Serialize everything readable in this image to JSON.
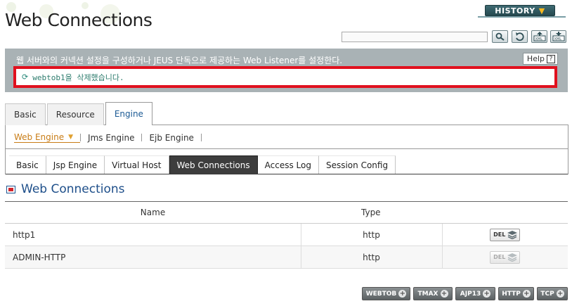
{
  "header": {
    "title": "Web Connections",
    "history_label": "HISTORY",
    "search": {
      "value": "",
      "placeholder": ""
    },
    "tools": [
      "search-icon",
      "refresh-icon",
      "export-xml-icon",
      "import-xml-icon"
    ]
  },
  "info": {
    "description": "웹 서버와의 커넥션 설정을 구성하거나 JEUS 단독으로 제공하는 Web Listener를 설정한다.",
    "help_label": "Help",
    "help_icon": "?",
    "message": "webtob1을 삭제했습니다."
  },
  "tabs_main": [
    {
      "label": "Basic",
      "active": false
    },
    {
      "label": "Resource",
      "active": false
    },
    {
      "label": "Engine",
      "active": true
    }
  ],
  "subnav": [
    {
      "label": "Web Engine",
      "active": true
    },
    {
      "label": "Jms Engine",
      "active": false
    },
    {
      "label": "Ejb Engine",
      "active": false
    }
  ],
  "tabs_sub": [
    {
      "label": "Basic",
      "active": false
    },
    {
      "label": "Jsp Engine",
      "active": false
    },
    {
      "label": "Virtual Host",
      "active": false
    },
    {
      "label": "Web Connections",
      "active": true
    },
    {
      "label": "Access Log",
      "active": false
    },
    {
      "label": "Session Config",
      "active": false
    }
  ],
  "section": {
    "title": "Web Connections"
  },
  "table": {
    "columns": [
      "Name",
      "Type"
    ],
    "rows": [
      {
        "name": "http1",
        "type": "http",
        "action": "DEL",
        "enabled": true
      },
      {
        "name": "ADMIN-HTTP",
        "type": "http",
        "action": "DEL",
        "enabled": false
      }
    ]
  },
  "add_buttons": [
    "WEBTOB",
    "TMAX",
    "AJP13",
    "HTTP",
    "TCP"
  ],
  "colors": {
    "accent_blue": "#1e4f8a",
    "alert_red": "#e0101e",
    "history_bg": "#25494f",
    "subnav_active": "#c97d17"
  }
}
